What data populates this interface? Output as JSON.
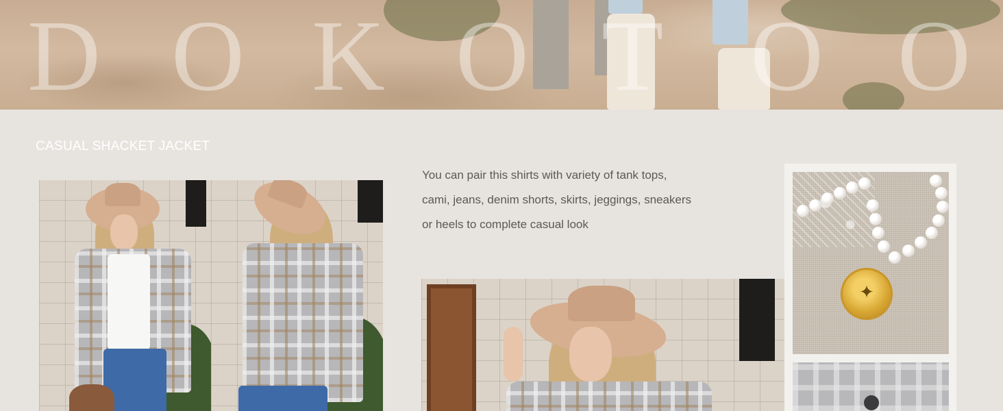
{
  "hero": {
    "brand_letters": [
      "D",
      "O",
      "K",
      "O",
      "T",
      "O",
      "O"
    ]
  },
  "section": {
    "title": "CASUAL SHACKET JACKET"
  },
  "description": {
    "lines": [
      "You can pair this shirts with variety of tank tops,",
      "cami, jeans, denim shorts, skirts, jeggings, sneakers",
      "or heels to complete casual look"
    ]
  },
  "colors": {
    "background": "#e7e4e0",
    "title_text": "#ffffff",
    "body_text": "#5b5855",
    "brand_overlay": "rgba(255,255,255,0.42)"
  }
}
